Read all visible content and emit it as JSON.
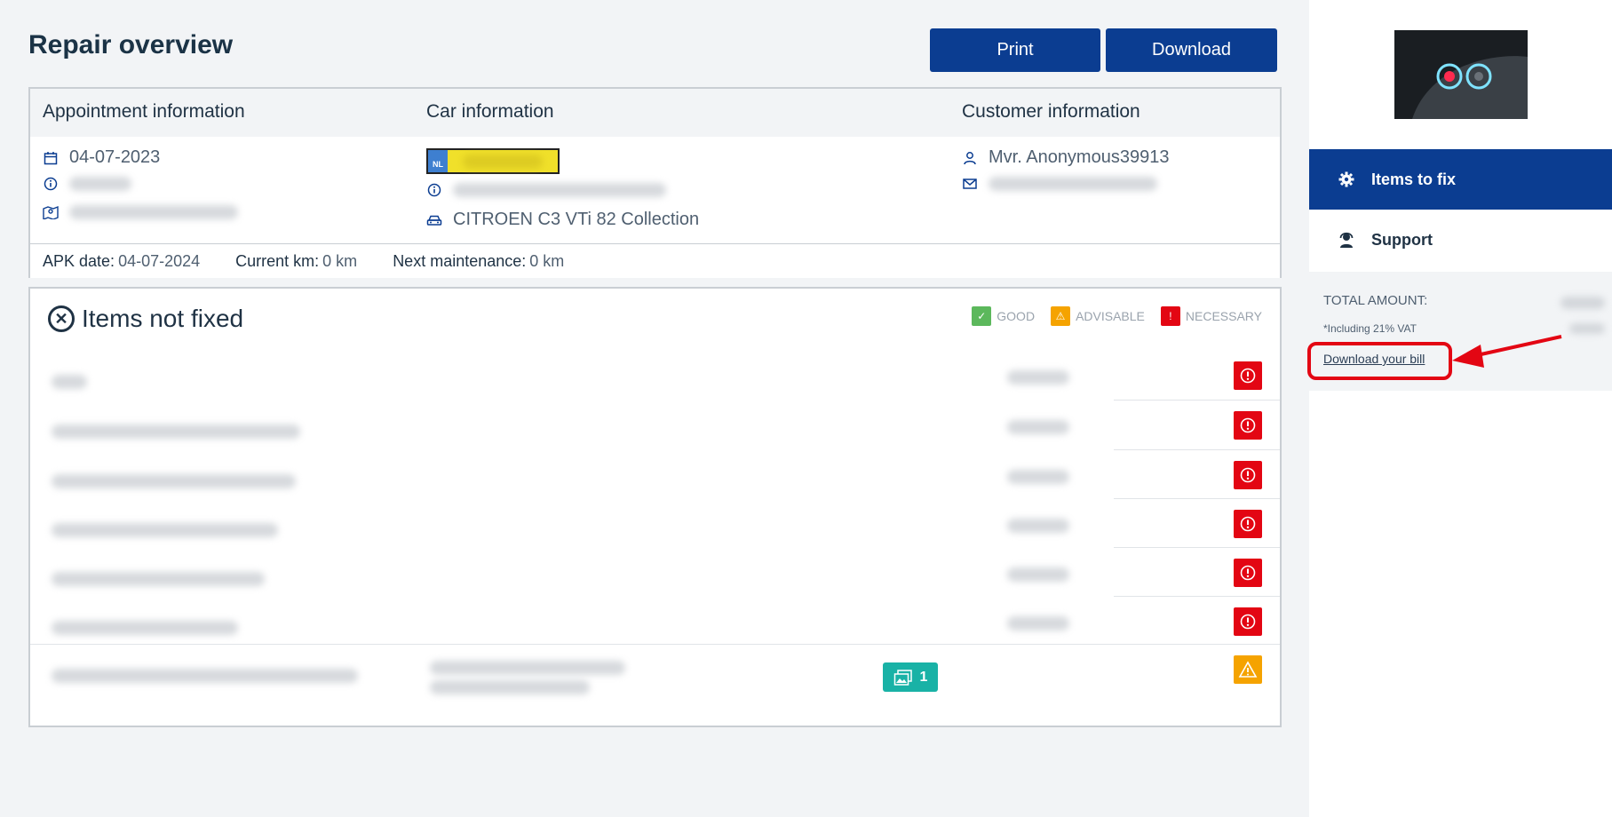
{
  "page": {
    "title": "Repair overview"
  },
  "toolbar": {
    "print_label": "Print",
    "download_label": "Download"
  },
  "info": {
    "appointment_header": "Appointment information",
    "car_header": "Car information",
    "customer_header": "Customer information",
    "appointment_date": "04-07-2023",
    "plate_country": "NL",
    "car_model": "CITROEN C3 VTi 82 Collection",
    "customer_name": "Mvr. Anonymous39913",
    "apk_label": "APK date:",
    "apk_value": "04-07-2024",
    "km_label": "Current km:",
    "km_value": "0 km",
    "maint_label": "Next maintenance:",
    "maint_value": "0 km"
  },
  "items": {
    "title": "Items not fixed",
    "legend": {
      "good": "GOOD",
      "advisable": "ADVISABLE",
      "necessary": "NECESSARY"
    },
    "rows": [
      {
        "status": "necessary"
      },
      {
        "status": "necessary"
      },
      {
        "status": "necessary"
      },
      {
        "status": "necessary"
      },
      {
        "status": "necessary"
      },
      {
        "status": "necessary"
      },
      {
        "status": "advisable",
        "photo_count": "1"
      }
    ]
  },
  "sidebar": {
    "nav_items_to_fix": "Items to fix",
    "nav_support": "Support",
    "total_label": "TOTAL AMOUNT:",
    "vat_note": "*Including 21% VAT",
    "download_bill": "Download your bill"
  },
  "colors": {
    "primary": "#0b3d91",
    "necessary": "#e30613",
    "advisable": "#f5a300",
    "good": "#5cb85c",
    "photo": "#19b2a6"
  },
  "icons": [
    "calendar-icon",
    "info-icon",
    "map-icon",
    "car-icon",
    "user-icon",
    "mail-icon",
    "gear-icon",
    "support-icon",
    "close-circle-icon",
    "image-icon",
    "warning-icon",
    "exclamation-icon"
  ]
}
